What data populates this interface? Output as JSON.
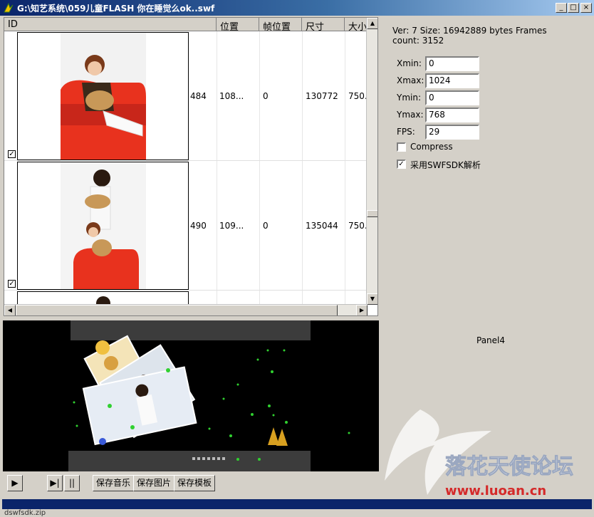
{
  "window": {
    "title": "G:\\知艺系统\\059儿童FLASH 你在睡觉么ok..swf",
    "minimize": "_",
    "maximize": "□",
    "close": "×"
  },
  "list": {
    "columns": [
      "ID",
      "位置",
      "帧位置",
      "尺寸",
      "大小"
    ],
    "rows": [
      {
        "id_value": "484",
        "position": "108...",
        "frame_position": "0",
        "size": "130772",
        "bytes": "750.",
        "checked": true
      },
      {
        "id_value": "490",
        "position": "109...",
        "frame_position": "0",
        "size": "135044",
        "bytes": "750.",
        "checked": true
      }
    ]
  },
  "info": {
    "header": "Ver: 7   Size: 16942889 bytes   Frames count: 3152"
  },
  "props": [
    {
      "label": "Xmin:",
      "value": "0"
    },
    {
      "label": "Xmax:",
      "value": "1024"
    },
    {
      "label": "Ymin:",
      "value": "0"
    },
    {
      "label": "Ymax:",
      "value": "768"
    },
    {
      "label": "FPS:",
      "value": "29"
    }
  ],
  "options": {
    "compress": {
      "label": "Compress",
      "checked": false
    },
    "swfsdk": {
      "label": "采用SWFSDK解析",
      "checked": true
    }
  },
  "panel4_label": "Panel4",
  "controls": {
    "play": "▶",
    "step": "▶|",
    "pause": "||",
    "save_music": "保存音乐",
    "save_image": "保存图片",
    "save_template": "保存模板"
  },
  "watermark": {
    "text": "落花天使论坛",
    "url": "www.luoan.cn"
  },
  "statusbar": {
    "tail_text": "dswfsdk.zip"
  },
  "colors": {
    "titlebar": "#0a246a",
    "face": "#d4d0c8",
    "sofa": "#e8321e"
  }
}
